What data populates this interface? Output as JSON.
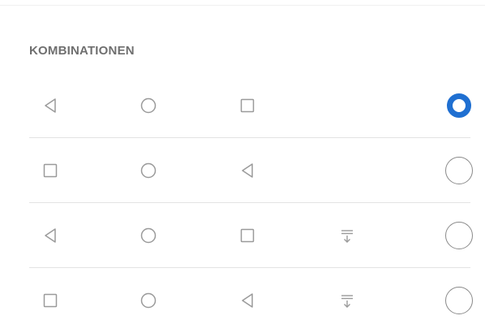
{
  "section": {
    "title": "KOMBINATIONEN"
  },
  "colors": {
    "accent": "#1f6fd1",
    "icon": "#9a9a9a",
    "divider": "#e3e3e3",
    "title": "#6f6f6f"
  },
  "combinations": [
    {
      "icons": [
        "back-icon",
        "home-icon",
        "recents-icon"
      ],
      "selected": true
    },
    {
      "icons": [
        "recents-icon",
        "home-icon",
        "back-icon"
      ],
      "selected": false
    },
    {
      "icons": [
        "back-icon",
        "home-icon",
        "recents-icon",
        "notification-pulldown-icon"
      ],
      "selected": false
    },
    {
      "icons": [
        "recents-icon",
        "home-icon",
        "back-icon",
        "notification-pulldown-icon"
      ],
      "selected": false
    }
  ]
}
